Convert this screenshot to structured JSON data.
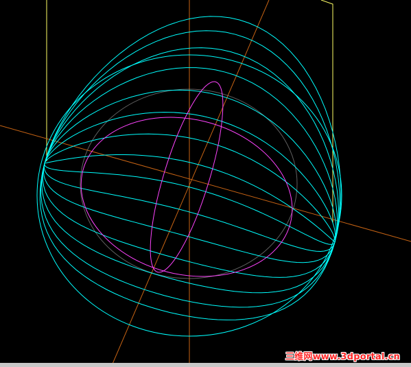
{
  "scene": {
    "background_color": "#000000",
    "wire_color": "#00ffff",
    "equator_color": "#ff44ff",
    "axis_color": "#c86414",
    "frame_color": "#ffff66",
    "guide_color": "#8a8a8a"
  },
  "watermark": {
    "text": "三维网www.3dportal.cn",
    "color": "#ff2a2a"
  }
}
